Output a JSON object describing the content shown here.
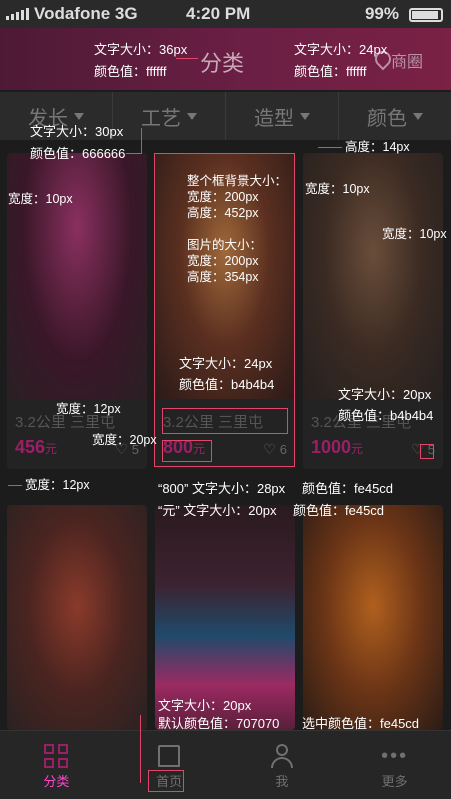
{
  "status": {
    "carrier": "Vodafone 3G",
    "time": "4:20 PM",
    "battery": "99%"
  },
  "header": {
    "title": "分类",
    "map_label": "商圈"
  },
  "filters": [
    "发长",
    "工艺",
    "造型",
    "颜色"
  ],
  "cards": [
    {
      "distance": "3.2公里 三里屯",
      "price": "456",
      "unit": "元",
      "likes": "5"
    },
    {
      "distance": "3.2公里 三里屯",
      "price": "800",
      "unit": "元",
      "likes": "6"
    },
    {
      "distance": "3.2公里 三里屯",
      "price": "1000",
      "unit": "元",
      "likes": "5"
    }
  ],
  "tabs": [
    {
      "label": "分类",
      "icon": "grid-icon",
      "active": true
    },
    {
      "label": "首页",
      "icon": "home-icon",
      "active": false
    },
    {
      "label": "我",
      "icon": "person-icon",
      "active": false
    },
    {
      "label": "更多",
      "icon": "more-icon",
      "active": false
    }
  ],
  "annotations": {
    "header_left_size": "文字大小：36px",
    "header_left_color": "颜色值：ffffff",
    "header_right_size": "文字大小：24px",
    "header_right_color": "颜色值：ffffff",
    "filter_size": "文字大小：30px",
    "filter_color": "颜色值：666666",
    "top_gap": "高度：14px",
    "width_left": "宽度：10px",
    "width_mid": "宽度：10px",
    "width_right": "宽度：10px",
    "box_title": "整个框背景大小：",
    "box_width": "宽度：200px",
    "box_height": "高度：452px",
    "img_title": "图片的大小：",
    "img_width": "宽度：200px",
    "img_height": "高度：354px",
    "dist_size": "文字大小：24px",
    "dist_color": "颜色值：b4b4b4",
    "right_size": "文字大小：20px",
    "right_color": "颜色值：b4b4b4",
    "gap_12a": "宽度：12px",
    "gap_20": "宽度：20px",
    "gap_12b": "宽度：12px",
    "price_size": "“800” 文字大小：28px",
    "unit_size": "“元” 文字大小：20px",
    "price_color1": "颜色值：fe45cd",
    "price_color2": "颜色值：fe45cd",
    "tab_size": "文字大小：20px",
    "tab_default": "默认颜色值：707070",
    "tab_selected": "选中颜色值：fe45cd"
  }
}
